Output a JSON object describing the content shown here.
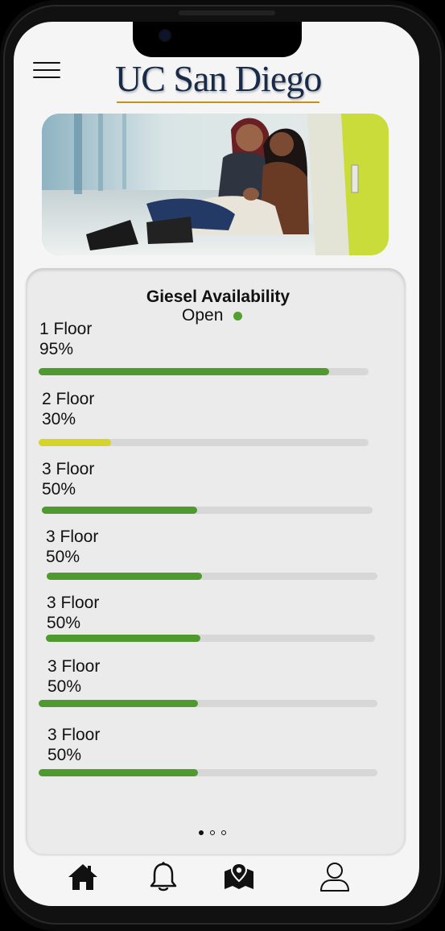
{
  "header": {
    "logo_text": "UC San Diego",
    "menu_icon": "hamburger-menu-icon",
    "brand_color": "#182b49",
    "accent_color": "#c69214"
  },
  "availability": {
    "title": "Giesel Availability",
    "status": "Open",
    "status_color": "#53a030",
    "floors": [
      {
        "name": "1 Floor",
        "percent_label": "95%",
        "fill_fraction": 0.88,
        "color": "#4f9a2f"
      },
      {
        "name": "2 Floor",
        "percent_label": "30%",
        "fill_fraction": 0.22,
        "color": "#d4d42a"
      },
      {
        "name": "3 Floor",
        "percent_label": "50%",
        "fill_fraction": 0.47,
        "color": "#4f9a2f"
      },
      {
        "name": "3 Floor",
        "percent_label": "50%",
        "fill_fraction": 0.47,
        "color": "#4f9a2f"
      },
      {
        "name": "3 Floor",
        "percent_label": "50%",
        "fill_fraction": 0.47,
        "color": "#4f9a2f"
      },
      {
        "name": "3 Floor",
        "percent_label": "50%",
        "fill_fraction": 0.47,
        "color": "#4f9a2f"
      },
      {
        "name": "3 Floor",
        "percent_label": "50%",
        "fill_fraction": 0.47,
        "color": "#4f9a2f"
      }
    ],
    "pager": {
      "pages": 3,
      "active": 0
    }
  },
  "bottom_nav": {
    "items": [
      {
        "icon": "home-icon"
      },
      {
        "icon": "bell-icon"
      },
      {
        "icon": "map-pin-icon"
      },
      {
        "icon": "user-icon"
      }
    ]
  }
}
